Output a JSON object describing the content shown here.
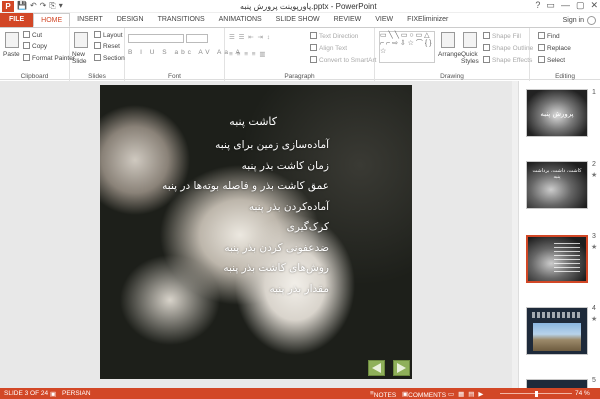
{
  "titlebar": {
    "app_logo": "P",
    "title": "پاورپوینت پرورش پنبه.pptx - PowerPoint",
    "qat": [
      "💾",
      "↶",
      "↷",
      "⎘",
      "▾"
    ],
    "window_buttons": [
      "?",
      "▭",
      "—",
      "▢",
      "✕"
    ]
  },
  "tabs": [
    "FILE",
    "HOME",
    "INSERT",
    "DESIGN",
    "TRANSITIONS",
    "ANIMATIONS",
    "SLIDE SHOW",
    "REVIEW",
    "VIEW",
    "FIXEliminizer"
  ],
  "signin": "Sign in",
  "ribbon": {
    "clipboard": {
      "label": "Clipboard",
      "paste": "Paste",
      "cut": "Cut",
      "copy": "Copy",
      "format_painter": "Format Painter"
    },
    "slides": {
      "label": "Slides",
      "new_slide": "New Slide",
      "layout": "Layout",
      "reset": "Reset",
      "section": "Section"
    },
    "font": {
      "label": "Font",
      "font_name": "",
      "font_size": "",
      "buttons": [
        "B",
        "I",
        "U",
        "S",
        "abc",
        "AV",
        "Aa",
        "A"
      ]
    },
    "paragraph": {
      "label": "Paragraph",
      "text_direction": "Text Direction",
      "align_text": "Align Text",
      "convert_smartart": "Convert to SmartArt"
    },
    "drawing": {
      "label": "Drawing",
      "arrange": "Arrange",
      "quick_styles": "Quick Styles",
      "shape_fill": "Shape Fill",
      "shape_outline": "Shape Outline",
      "shape_effects": "Shape Effects"
    },
    "editing": {
      "label": "Editing",
      "find": "Find",
      "replace": "Replace",
      "select": "Select"
    }
  },
  "slide": {
    "title": "کاشت پنبه",
    "bullets": [
      "آماده‌سازی زمین برای پنبه",
      "زمان کاشت بذر پنبه",
      "عمق کاشت بذر و فاصله بوته‌ها در پنبه",
      "آماده‌کردن بذر پنبه",
      "کرک‌گیری",
      "ضدعفونی کردن بذر پنبه",
      "روش‌های کاشت بذر پنبه",
      "مقدار بذر پنبه"
    ]
  },
  "thumbnails": [
    {
      "num": "1",
      "text": "پرورش پنبه",
      "star": ""
    },
    {
      "num": "2",
      "text": "کاشت، داشت، برداشت پنبه",
      "star": "★"
    },
    {
      "num": "3",
      "text": "",
      "star": "★"
    },
    {
      "num": "4",
      "text": "",
      "star": "★"
    },
    {
      "num": "5",
      "text": "",
      "star": ""
    }
  ],
  "statusbar": {
    "slide_info": "SLIDE 3 OF 24",
    "language": "PERSIAN",
    "notes": "NOTES",
    "comments": "COMMENTS",
    "zoom": "74 %"
  },
  "colors": {
    "accent": "#d24726",
    "nav_button": "#8fb05a"
  }
}
